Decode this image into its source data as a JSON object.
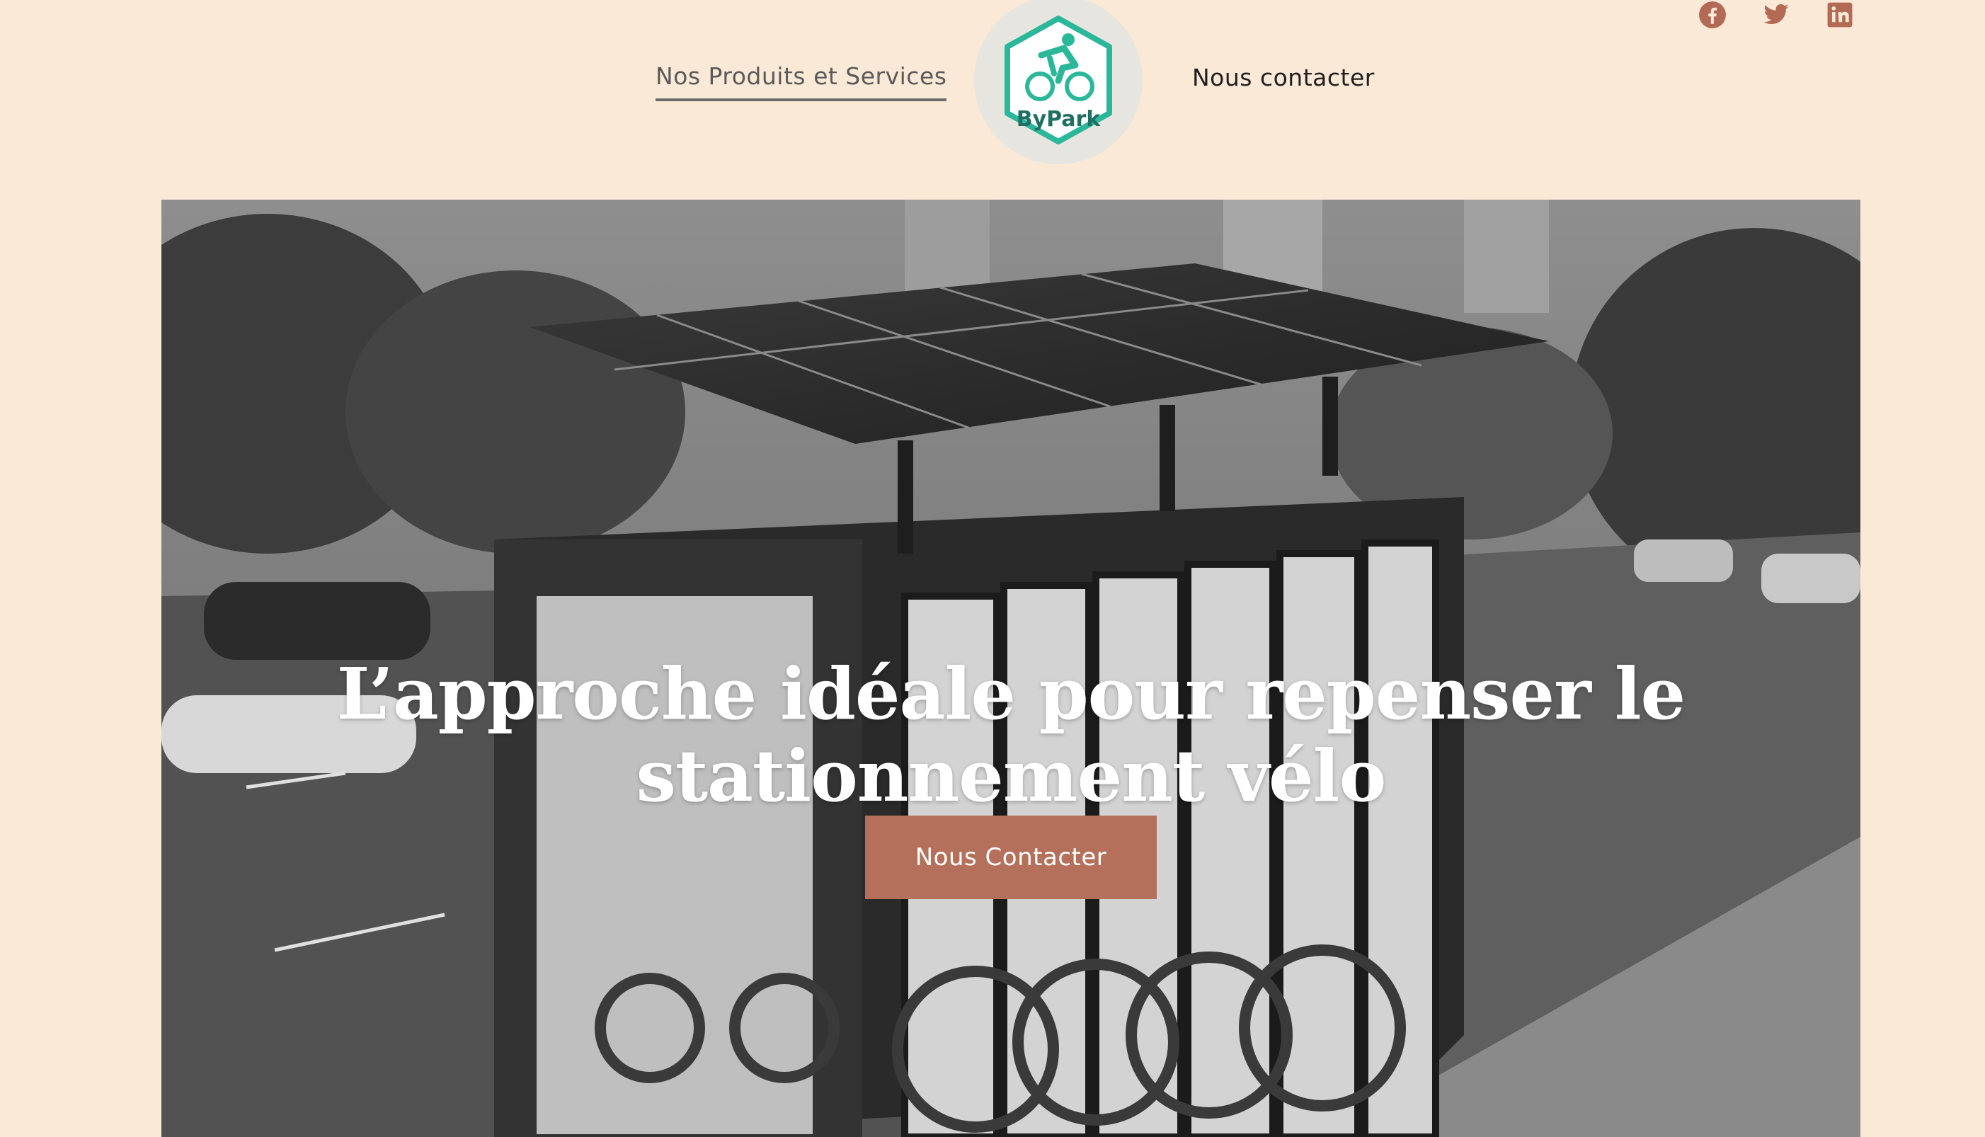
{
  "header": {
    "nav_left": "Nos Produits et Services",
    "nav_right": "Nous contacter",
    "logo": {
      "text": "ByPark",
      "icon": "cyclist-hexagon-logo",
      "color": "#2bb79a"
    },
    "social": [
      {
        "icon": "facebook-icon"
      },
      {
        "icon": "twitter-icon"
      },
      {
        "icon": "linkedin-icon"
      }
    ],
    "social_color": "#b36a55"
  },
  "hero": {
    "title": "L’approche idéale pour repenser le stationnement vélo",
    "cta_label": "Nous Contacter",
    "cta_color": "#b4705a",
    "background": "grayscale photo of a solar-roof bicycle shelter on a city street"
  }
}
